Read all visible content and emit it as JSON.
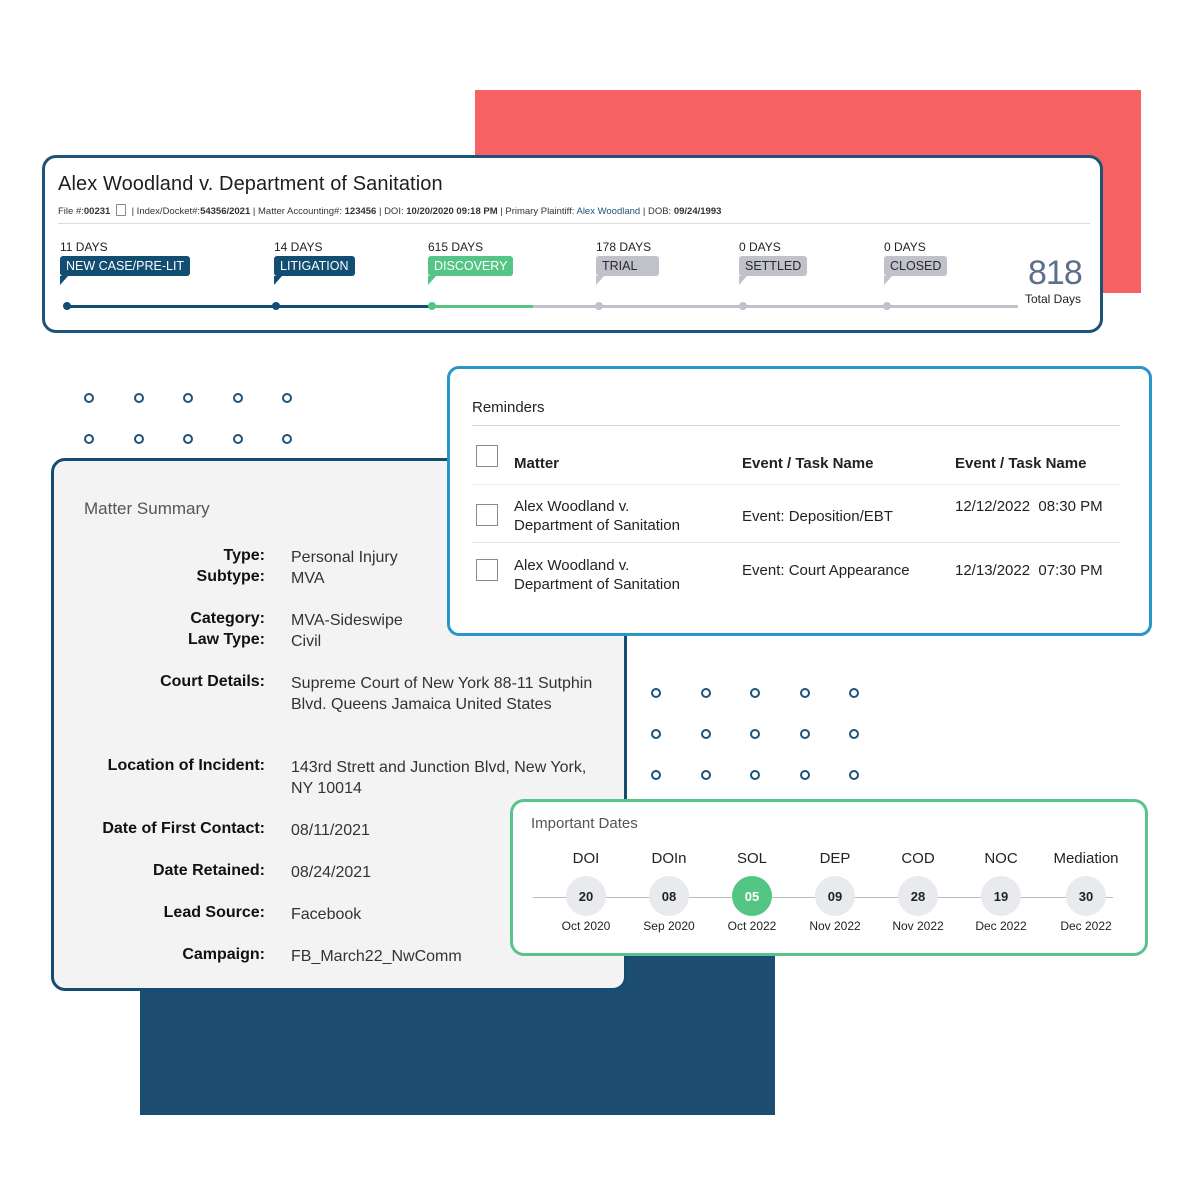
{
  "colors": {
    "navy": "#1b5478",
    "green": "#55c585",
    "coral": "#f66263",
    "gray_tag": "#c0c1c9",
    "blue_border": "#2a95c8"
  },
  "header": {
    "title": "Alex Woodland v. Department of Sanitation",
    "meta": {
      "file_label": "File #:",
      "file_value": "00231",
      "docket_label": "| Index/Docket#:",
      "docket_value": "54356/2021",
      "accounting_label": "| Matter Accounting#:",
      "accounting_value": "123456",
      "doi_label": "| DOI:",
      "doi_value": "10/20/2020 09:18 PM",
      "plaintiff_label": "| Primary Plaintiff:",
      "plaintiff_value": "Alex Woodland",
      "dob_label": "| DOB:",
      "dob_value": "09/24/1993"
    },
    "stages": [
      {
        "days": "11 DAYS",
        "label": "NEW CASE/PRE-LIT",
        "status": "completed"
      },
      {
        "days": "14 DAYS",
        "label": "LITIGATION",
        "status": "completed"
      },
      {
        "days": "615 DAYS",
        "label": "DISCOVERY",
        "status": "current"
      },
      {
        "days": "178 DAYS",
        "label": "TRIAL",
        "status": "pending"
      },
      {
        "days": "0 DAYS",
        "label": "SETTLED",
        "status": "pending"
      },
      {
        "days": "0 DAYS",
        "label": "CLOSED",
        "status": "pending"
      }
    ],
    "total_days": "818",
    "total_label": "Total Days"
  },
  "reminders": {
    "title": "Reminders",
    "columns": [
      "Matter",
      "Event / Task Name",
      "Event / Task Name"
    ],
    "rows": [
      {
        "matter_line1": "Alex Woodland v.",
        "matter_line2": "Department of Sanitation",
        "event": "Event: Deposition/EBT",
        "date": "12/12/2022",
        "time": "08:30 PM"
      },
      {
        "matter_line1": "Alex Woodland v.",
        "matter_line2": "Department of Sanitation",
        "event": "Event: Court Appearance",
        "date": "12/13/2022",
        "time": "07:30 PM"
      }
    ]
  },
  "summary": {
    "title": "Matter Summary",
    "fields": [
      {
        "label": "Type:",
        "value": "Personal Injury"
      },
      {
        "label": "Subtype:",
        "value": "MVA"
      },
      {
        "label": "Category:",
        "value": "MVA-Sideswipe"
      },
      {
        "label": "Law Type:",
        "value": "Civil"
      },
      {
        "label": "Court Details:",
        "value": "Supreme Court of New York 88-11 Sutphin Blvd. Queens Jamaica United States"
      },
      {
        "label": "Location of Incident:",
        "value": "143rd Strett and Junction Blvd, New York, NY 10014"
      },
      {
        "label": "Date of First Contact:",
        "value": "08/11/2021"
      },
      {
        "label": "Date Retained:",
        "value": "08/24/2021"
      },
      {
        "label": "Lead Source:",
        "value": "Facebook"
      },
      {
        "label": "Campaign:",
        "value": "FB_March22_NwComm"
      }
    ]
  },
  "important_dates": {
    "title": "Important Dates",
    "items": [
      {
        "code": "DOI",
        "day": "20",
        "month": "Oct 2020",
        "active": false
      },
      {
        "code": "DOIn",
        "day": "08",
        "month": "Sep 2020",
        "active": false
      },
      {
        "code": "SOL",
        "day": "05",
        "month": "Oct 2022",
        "active": true
      },
      {
        "code": "DEP",
        "day": "09",
        "month": "Nov 2022",
        "active": false
      },
      {
        "code": "COD",
        "day": "28",
        "month": "Nov 2022",
        "active": false
      },
      {
        "code": "NOC",
        "day": "19",
        "month": "Dec 2022",
        "active": false
      },
      {
        "code": "Mediation",
        "day": "30",
        "month": "Dec 2022",
        "active": false
      }
    ]
  }
}
